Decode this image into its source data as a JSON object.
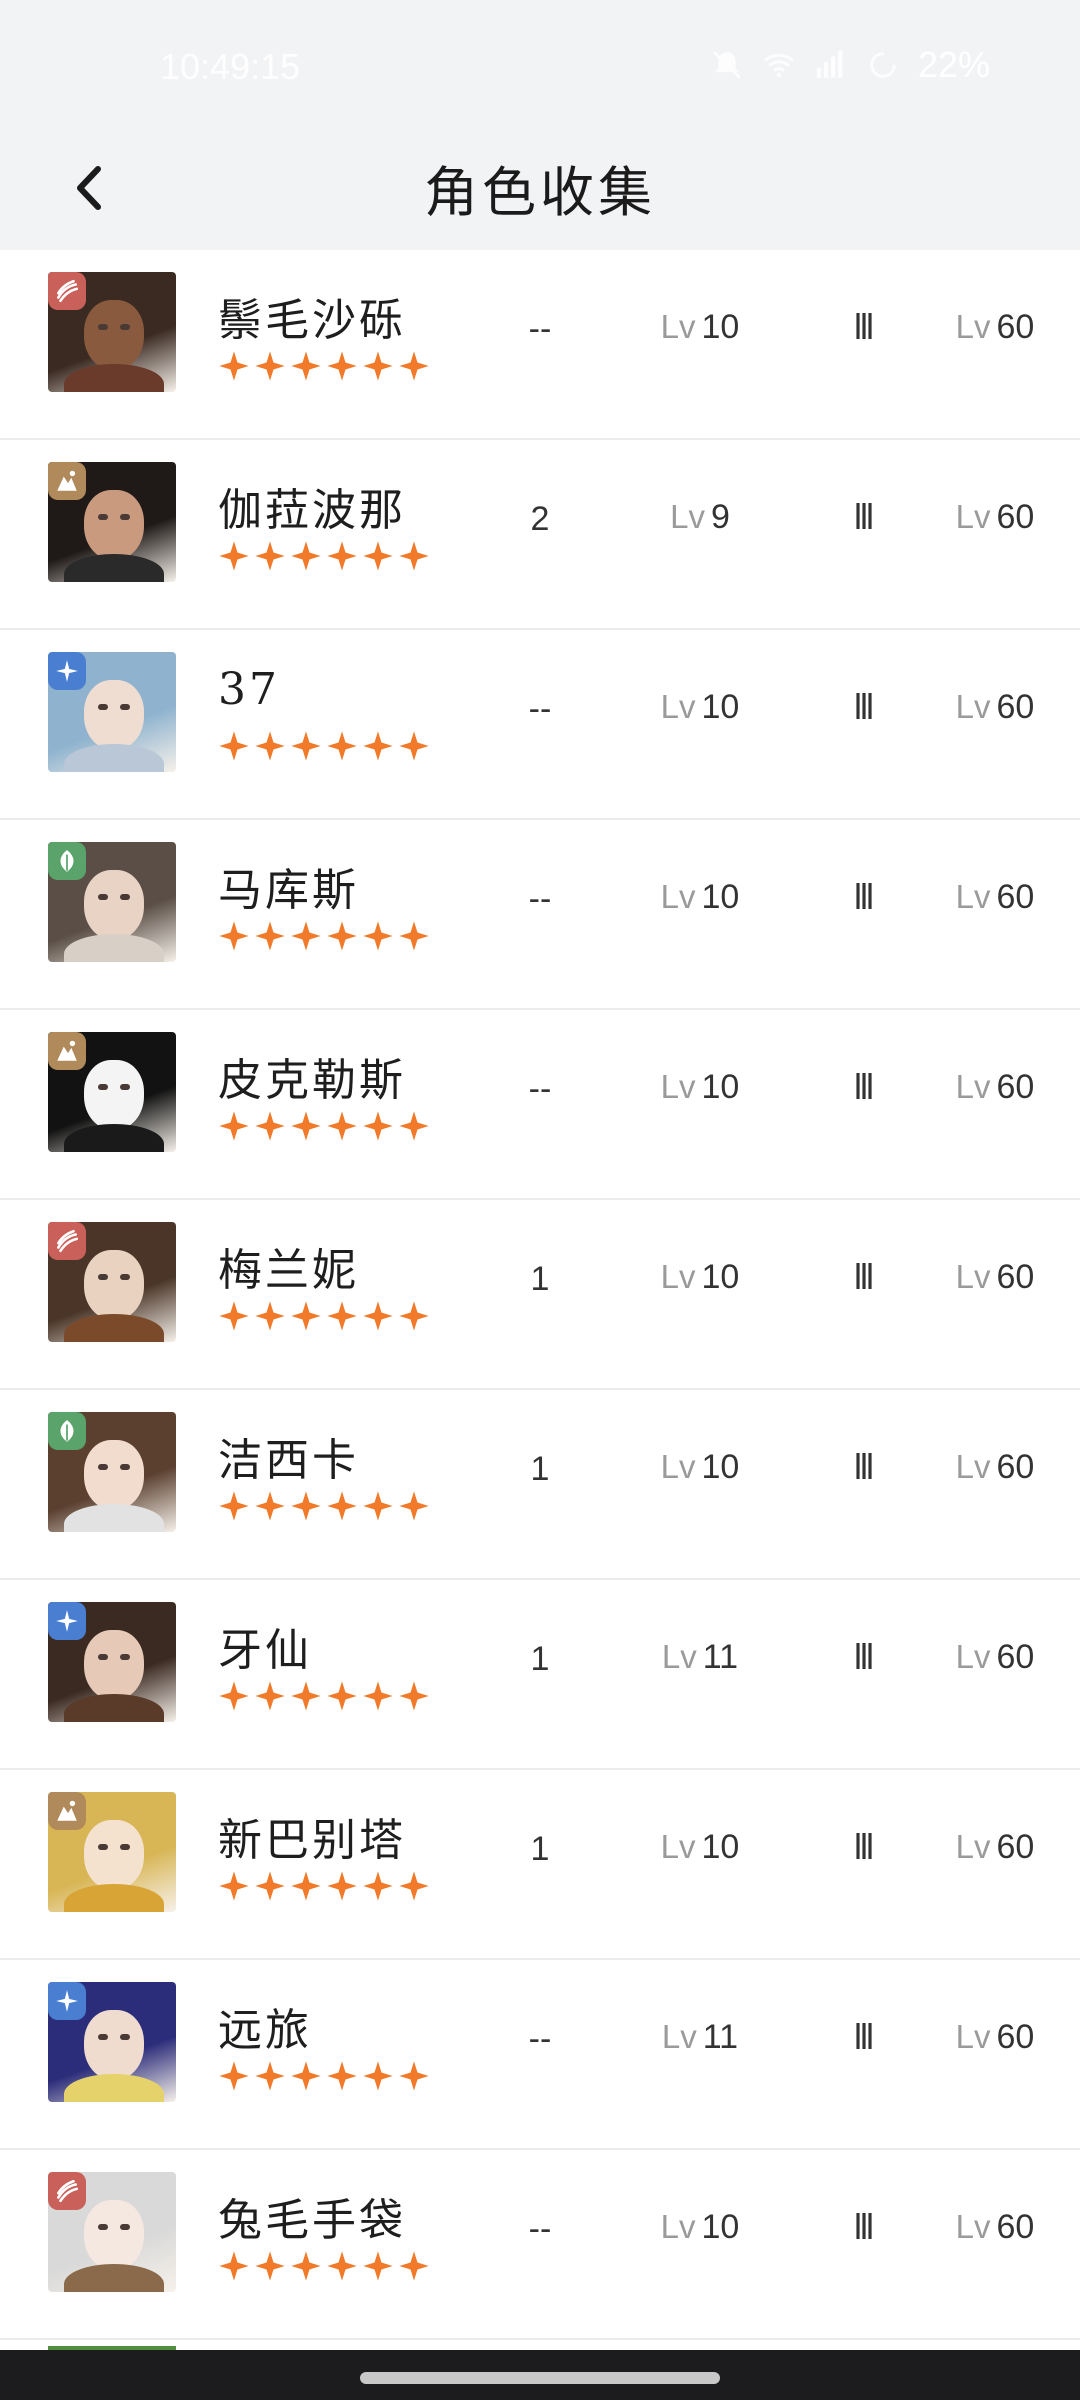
{
  "status_bar": {
    "time": "10:49:15",
    "battery": "22%",
    "icons": [
      "mute-icon",
      "wifi-icon",
      "signal-icon",
      "battery-saver-icon"
    ]
  },
  "header": {
    "title": "角色收集",
    "back_icon": "chevron-left-icon"
  },
  "colors": {
    "star": "#f07a2a",
    "element_red": "#c9605a",
    "element_gold": "#b08a5a",
    "element_blue": "#4a7ed0",
    "element_green": "#5aa36a"
  },
  "characters": [
    {
      "name": "鬃毛沙砾",
      "element": "beast-claw-icon",
      "stars": 6,
      "count": "--",
      "level_prefix": "Lv",
      "level": "10",
      "rank": "lll",
      "max_prefix": "Lv",
      "max_level": "60"
    },
    {
      "name": "伽菈波那",
      "element": "mineral-icon",
      "stars": 6,
      "count": "2",
      "level_prefix": "Lv",
      "level": "9",
      "rank": "lll",
      "max_prefix": "Lv",
      "max_level": "60"
    },
    {
      "name": "37",
      "element": "star-icon",
      "stars": 6,
      "count": "--",
      "level_prefix": "Lv",
      "level": "10",
      "rank": "lll",
      "max_prefix": "Lv",
      "max_level": "60"
    },
    {
      "name": "马库斯",
      "element": "plant-icon",
      "stars": 6,
      "count": "--",
      "level_prefix": "Lv",
      "level": "10",
      "rank": "lll",
      "max_prefix": "Lv",
      "max_level": "60"
    },
    {
      "name": "皮克勒斯",
      "element": "mineral-icon",
      "stars": 6,
      "count": "--",
      "level_prefix": "Lv",
      "level": "10",
      "rank": "lll",
      "max_prefix": "Lv",
      "max_level": "60"
    },
    {
      "name": "梅兰妮",
      "element": "beast-claw-icon",
      "stars": 6,
      "count": "1",
      "level_prefix": "Lv",
      "level": "10",
      "rank": "lll",
      "max_prefix": "Lv",
      "max_level": "60"
    },
    {
      "name": "洁西卡",
      "element": "plant-icon",
      "stars": 6,
      "count": "1",
      "level_prefix": "Lv",
      "level": "10",
      "rank": "lll",
      "max_prefix": "Lv",
      "max_level": "60"
    },
    {
      "name": "牙仙",
      "element": "star-icon",
      "stars": 6,
      "count": "1",
      "level_prefix": "Lv",
      "level": "11",
      "rank": "lll",
      "max_prefix": "Lv",
      "max_level": "60"
    },
    {
      "name": "新巴别塔",
      "element": "mineral-icon",
      "stars": 6,
      "count": "1",
      "level_prefix": "Lv",
      "level": "10",
      "rank": "lll",
      "max_prefix": "Lv",
      "max_level": "60"
    },
    {
      "name": "远旅",
      "element": "star-icon",
      "stars": 6,
      "count": "--",
      "level_prefix": "Lv",
      "level": "11",
      "rank": "lll",
      "max_prefix": "Lv",
      "max_level": "60"
    },
    {
      "name": "兔毛手袋",
      "element": "beast-claw-icon",
      "stars": 6,
      "count": "--",
      "level_prefix": "Lv",
      "level": "10",
      "rank": "lll",
      "max_prefix": "Lv",
      "max_level": "60"
    }
  ]
}
